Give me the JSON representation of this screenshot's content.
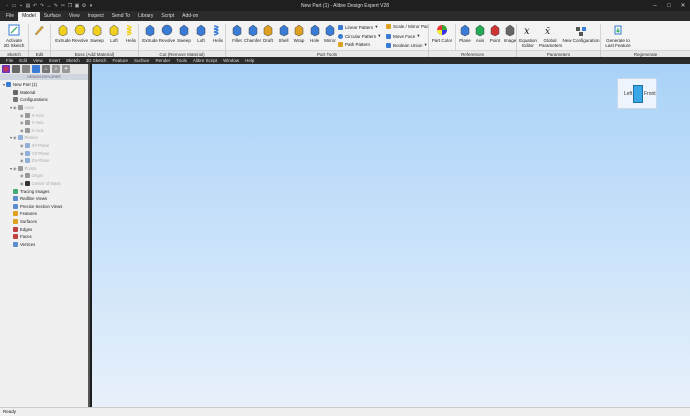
{
  "window": {
    "title": "New Part (1) - Alibre Design Expert V28"
  },
  "quick_access_icons": [
    "new-icon",
    "open-icon",
    "save-icon",
    "print-icon",
    "undo-icon",
    "redo-icon",
    "measure-icon",
    "pen-icon",
    "cut-icon",
    "copy-icon",
    "paste-icon",
    "settings-icon",
    "dropdown-icon"
  ],
  "menu_tabs": [
    "File",
    "Model",
    "Surface",
    "View",
    "Inspect",
    "Send To",
    "Library",
    "Script",
    "Add-on"
  ],
  "active_tab": "Model",
  "ribbon": {
    "sketch": {
      "activate": "Activate 2D Sketch"
    },
    "boss": [
      "Extrude",
      "Revolve",
      "Sweep",
      "Loft",
      "Helix"
    ],
    "cut": [
      "Extrude",
      "Revolve",
      "Sweep",
      "Loft",
      "Helix"
    ],
    "part_tools_big": [
      "Fillet",
      "Chamfer",
      "Draft",
      "Shell",
      "Wrap",
      "Hole",
      "Mirror"
    ],
    "part_tools_small": [
      "Linear Pattern",
      "Circular Pattern",
      "Path Pattern",
      "Scale / Mirror Part",
      "Move Face",
      "Boolean Union"
    ],
    "part_color": "Part Color",
    "references": [
      "Plane",
      "Axis",
      "Point",
      "Image"
    ],
    "parameters": [
      "Equation Editor",
      "Global Parameters",
      "New Configuration"
    ],
    "regenerate": "Generate to Last Feature"
  },
  "group_labels": [
    "Sketch",
    "Edit",
    "Boss (Add Material)",
    "Cut (Remove Material)",
    "Part Tools",
    "References",
    "Parameters",
    "Regenerate"
  ],
  "menubar": [
    "File",
    "Edit",
    "View",
    "Insert",
    "Sketch",
    "3D Sketch",
    "Feature",
    "Surface",
    "Render",
    "Tools",
    "Alibre Script",
    "Window",
    "Help"
  ],
  "tree": {
    "header": "DESIGN EXPLORER",
    "nodes": [
      {
        "label": "New Part (1)",
        "level": 0,
        "dim": false,
        "expand": "▾",
        "color": "#3a7bd5"
      },
      {
        "label": "Material",
        "level": 1,
        "dim": false,
        "expand": "",
        "color": "#666"
      },
      {
        "label": "Configurations",
        "level": 1,
        "dim": false,
        "expand": "",
        "color": "#777"
      },
      {
        "label": "Axes",
        "level": 1,
        "dim": true,
        "expand": "▾",
        "color": "#999"
      },
      {
        "label": "X-Axis",
        "level": 2,
        "dim": true,
        "expand": "",
        "color": "#999"
      },
      {
        "label": "Y-Axis",
        "level": 2,
        "dim": true,
        "expand": "",
        "color": "#999"
      },
      {
        "label": "Z-Axis",
        "level": 2,
        "dim": true,
        "expand": "",
        "color": "#999"
      },
      {
        "label": "Planes",
        "level": 1,
        "dim": true,
        "expand": "▾",
        "color": "#8fb0d8"
      },
      {
        "label": "XY-Plane",
        "level": 2,
        "dim": true,
        "expand": "",
        "color": "#8fb0d8"
      },
      {
        "label": "YZ-Plane",
        "level": 2,
        "dim": true,
        "expand": "",
        "color": "#8fb0d8"
      },
      {
        "label": "ZX-Plane",
        "level": 2,
        "dim": true,
        "expand": "",
        "color": "#8fb0d8"
      },
      {
        "label": "Points",
        "level": 1,
        "dim": true,
        "expand": "▾",
        "color": "#999"
      },
      {
        "label": "Origin",
        "level": 2,
        "dim": true,
        "expand": "",
        "color": "#999"
      },
      {
        "label": "Center of Mass",
        "level": 2,
        "dim": true,
        "expand": "",
        "color": "#333"
      },
      {
        "label": "Tracing Images",
        "level": 1,
        "dim": false,
        "expand": "",
        "color": "#4a7"
      },
      {
        "label": "Redline Views",
        "level": 1,
        "dim": false,
        "expand": "",
        "color": "#5b8ccc"
      },
      {
        "label": "Precise Section Views",
        "level": 1,
        "dim": false,
        "expand": "",
        "color": "#5b8ccc"
      },
      {
        "label": "Features",
        "level": 1,
        "dim": false,
        "expand": "",
        "color": "#e0a020"
      },
      {
        "label": "Surfaces",
        "level": 1,
        "dim": false,
        "expand": "",
        "color": "#e0a020"
      },
      {
        "label": "Edges",
        "level": 1,
        "dim": false,
        "expand": "",
        "color": "#c04040"
      },
      {
        "label": "Faces",
        "level": 1,
        "dim": false,
        "expand": "",
        "color": "#c04040"
      },
      {
        "label": "Vertices",
        "level": 1,
        "dim": false,
        "expand": "",
        "color": "#5b8ccc"
      }
    ]
  },
  "view_cube": {
    "left": "Left",
    "front": "Front"
  },
  "status": "Ready"
}
